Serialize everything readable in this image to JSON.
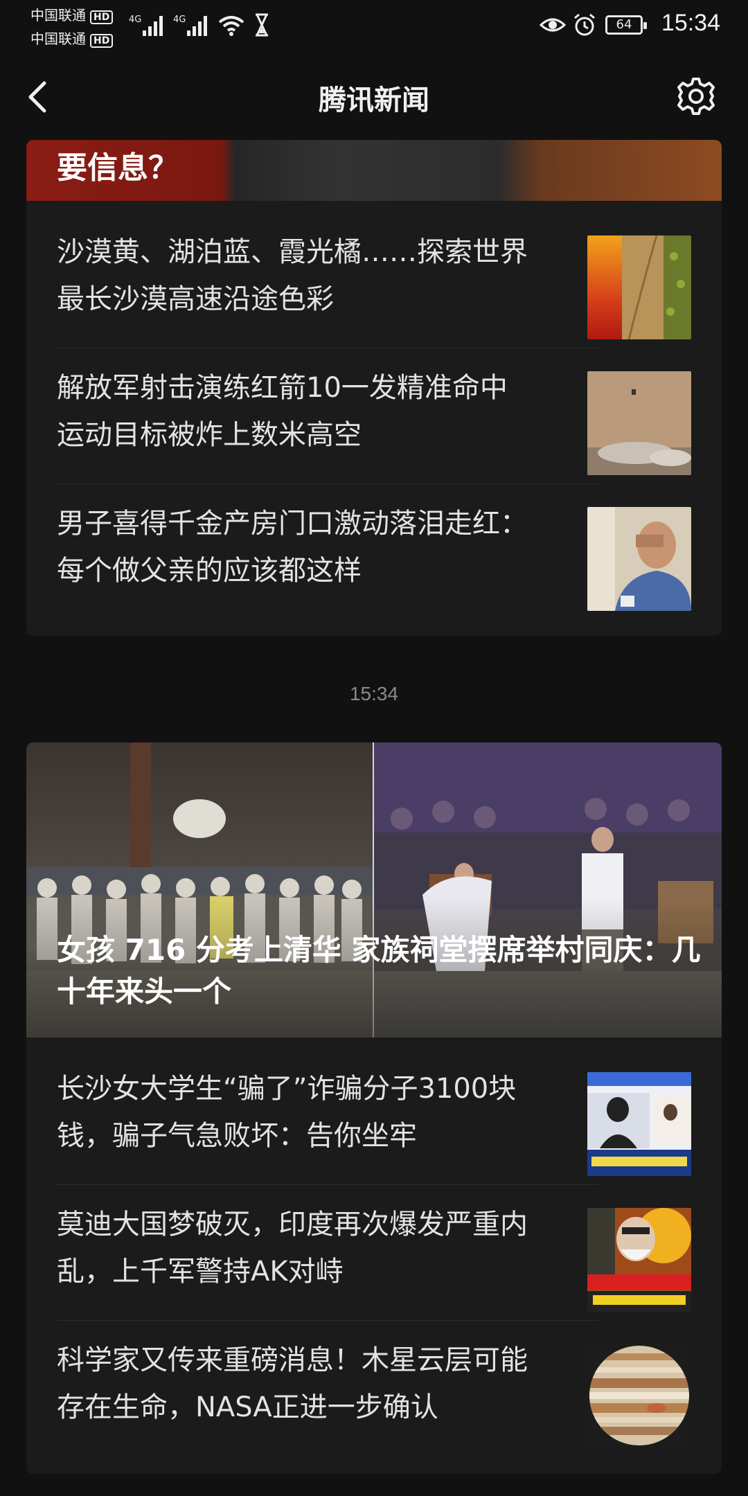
{
  "status_bar": {
    "carrier1": "中国联通",
    "carrier2": "中国联通",
    "hd": "HD",
    "net1": "4G",
    "net2": "4G",
    "battery": "64",
    "time": "15:34"
  },
  "header": {
    "title": "腾讯新闻"
  },
  "feed1": {
    "top_partial_title": "要信息？",
    "items": [
      {
        "title": "沙漠黄、湖泊蓝、霞光橘……探索世界最长沙漠高速沿途色彩"
      },
      {
        "title": "解放军射击演练红箭10一发精准命中 运动目标被炸上数米高空"
      },
      {
        "title": "男子喜得千金产房门口激动落泪走红：每个做父亲的应该都这样"
      }
    ]
  },
  "timestamp": "15:34",
  "feed2": {
    "banner_title": "女孩 716 分考上清华 家族祠堂摆席举村同庆：几十年来头一个",
    "items": [
      {
        "title": "长沙女大学生“骗了”诈骗分子3100块钱，骗子气急败坏：告你坐牢"
      },
      {
        "title": "莫迪大国梦破灭，印度再次爆发严重内乱，上千军警持AK对峙"
      },
      {
        "title": "科学家又传来重磅消息！木星云层可能存在生命，NASA正进一步确认"
      }
    ]
  }
}
